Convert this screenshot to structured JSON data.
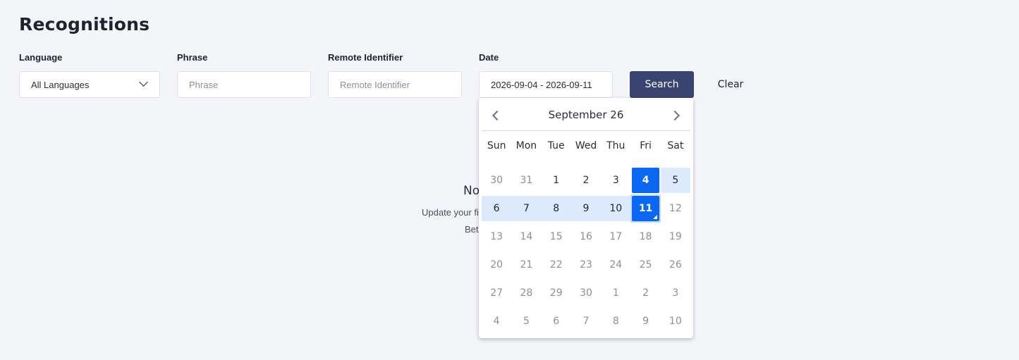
{
  "page": {
    "title": "Recognitions"
  },
  "filters": {
    "language": {
      "label": "Language",
      "value": "All Languages"
    },
    "phrase": {
      "label": "Phrase",
      "placeholder": "Phrase"
    },
    "remote_identifier": {
      "label": "Remote Identifier",
      "placeholder": "Remote Identifier"
    },
    "date": {
      "label": "Date",
      "value": "2026-09-04 - 2026-09-11"
    },
    "search_label": "Search",
    "clear_label": "Clear"
  },
  "empty_state": {
    "title": "No",
    "line1": "Update your fi",
    "line2": "Bet"
  },
  "calendar": {
    "title": "September 26",
    "weekdays": [
      "Sun",
      "Mon",
      "Tue",
      "Wed",
      "Thu",
      "Fri",
      "Sat"
    ],
    "weeks": [
      [
        {
          "d": "30",
          "s": "muted"
        },
        {
          "d": "31",
          "s": "muted"
        },
        {
          "d": "1",
          "s": "cur"
        },
        {
          "d": "2",
          "s": "cur"
        },
        {
          "d": "3",
          "s": "cur"
        },
        {
          "d": "4",
          "s": "selected"
        },
        {
          "d": "5",
          "s": "inrange"
        }
      ],
      [
        {
          "d": "6",
          "s": "inrange"
        },
        {
          "d": "7",
          "s": "inrange"
        },
        {
          "d": "8",
          "s": "inrange"
        },
        {
          "d": "9",
          "s": "inrange"
        },
        {
          "d": "10",
          "s": "inrange"
        },
        {
          "d": "11",
          "s": "selected end"
        },
        {
          "d": "12",
          "s": "muted"
        }
      ],
      [
        {
          "d": "13",
          "s": "muted"
        },
        {
          "d": "14",
          "s": "muted"
        },
        {
          "d": "15",
          "s": "muted"
        },
        {
          "d": "16",
          "s": "muted"
        },
        {
          "d": "17",
          "s": "muted"
        },
        {
          "d": "18",
          "s": "muted"
        },
        {
          "d": "19",
          "s": "muted"
        }
      ],
      [
        {
          "d": "20",
          "s": "muted"
        },
        {
          "d": "21",
          "s": "muted"
        },
        {
          "d": "22",
          "s": "muted"
        },
        {
          "d": "23",
          "s": "muted"
        },
        {
          "d": "24",
          "s": "muted"
        },
        {
          "d": "25",
          "s": "muted"
        },
        {
          "d": "26",
          "s": "muted"
        }
      ],
      [
        {
          "d": "27",
          "s": "muted"
        },
        {
          "d": "28",
          "s": "muted"
        },
        {
          "d": "29",
          "s": "muted"
        },
        {
          "d": "30",
          "s": "muted"
        },
        {
          "d": "1",
          "s": "muted"
        },
        {
          "d": "2",
          "s": "muted"
        },
        {
          "d": "3",
          "s": "muted"
        }
      ],
      [
        {
          "d": "4",
          "s": "muted"
        },
        {
          "d": "5",
          "s": "muted"
        },
        {
          "d": "6",
          "s": "muted"
        },
        {
          "d": "7",
          "s": "muted"
        },
        {
          "d": "8",
          "s": "muted"
        },
        {
          "d": "9",
          "s": "muted"
        },
        {
          "d": "10",
          "s": "muted"
        }
      ]
    ]
  },
  "colors": {
    "accent": "#0a68f5",
    "range": "#dceafb",
    "search_button": "#3a4470"
  }
}
